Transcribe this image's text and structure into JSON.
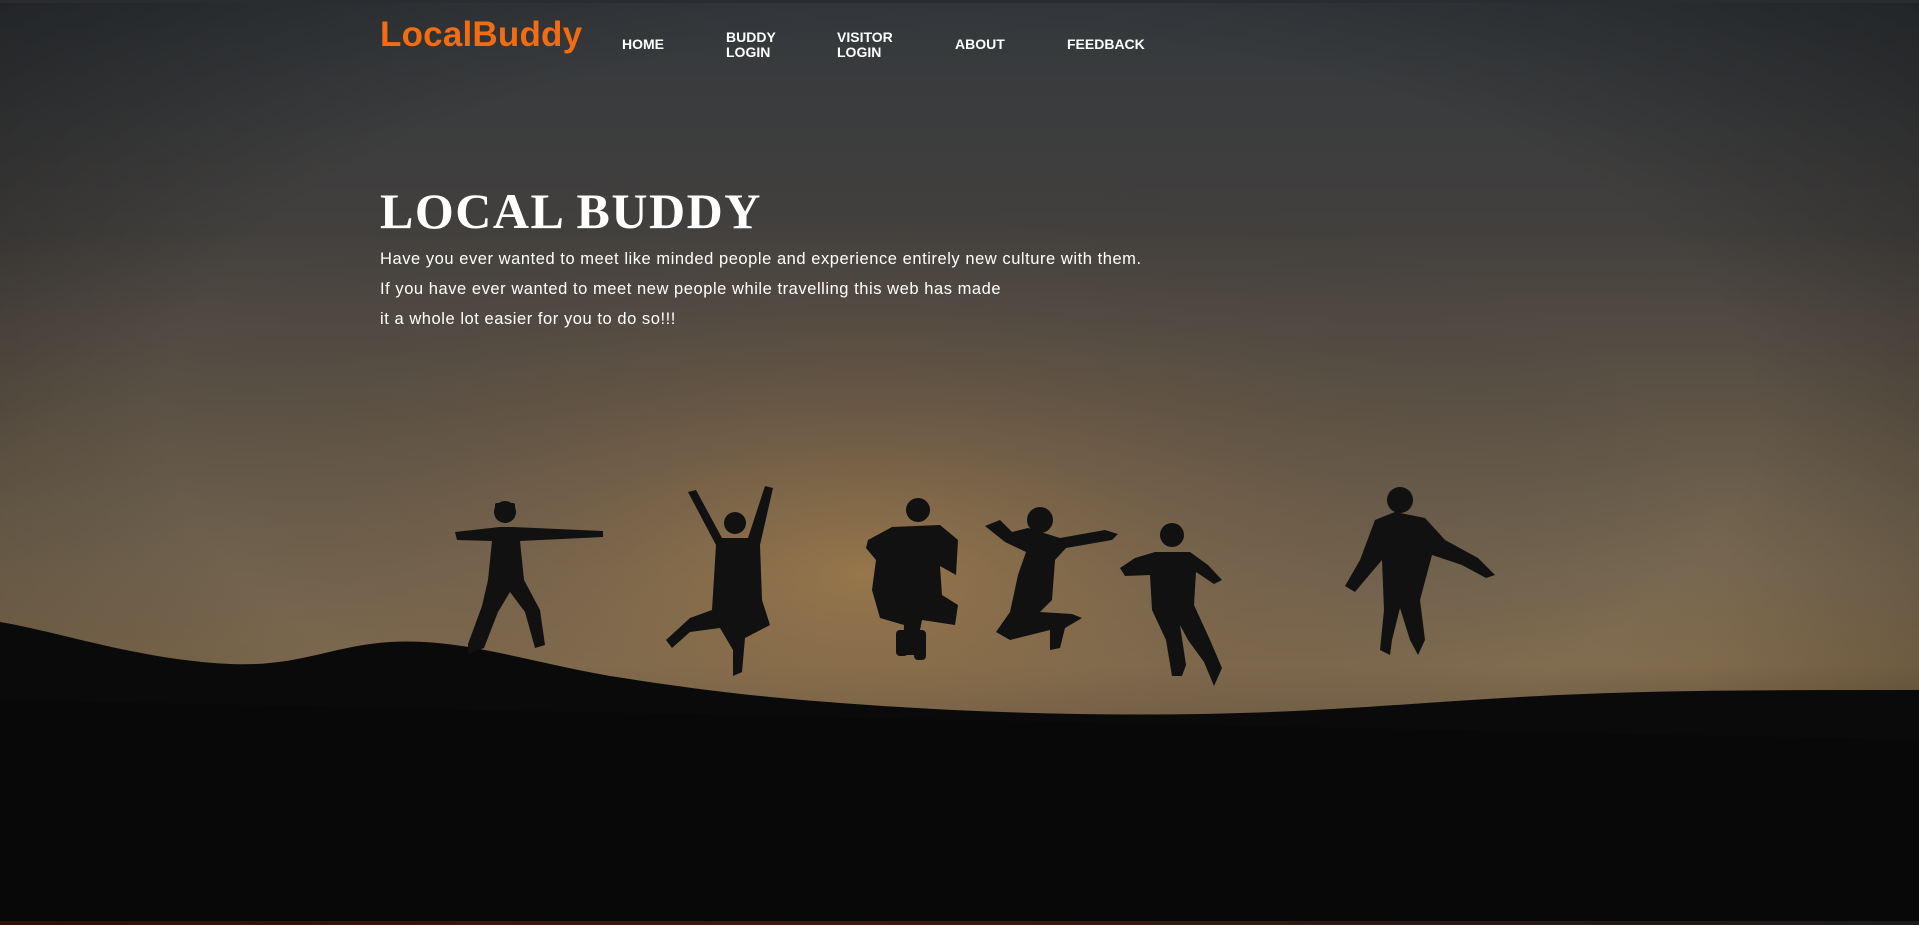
{
  "brand": {
    "logo_text": "LocalBuddy",
    "accent_color": "#f26d12"
  },
  "nav": {
    "home": "HOME",
    "buddy_login_line1": "BUDDY",
    "buddy_login_line2": "LOGIN",
    "visitor_login_line1": "VISITOR",
    "visitor_login_line2": "LOGIN",
    "about": "ABOUT",
    "feedback": "FEEDBACK"
  },
  "hero": {
    "title": "LOCAL BUDDY",
    "lines": [
      "Have you ever wanted to meet like minded people and experience entirely new culture with them.",
      "If you have ever wanted to meet new people while travelling this web has made",
      "it a whole lot easier for you to do so!!!"
    ],
    "background_image": "silhouettes-of-six-people-jumping-at-sunset"
  }
}
